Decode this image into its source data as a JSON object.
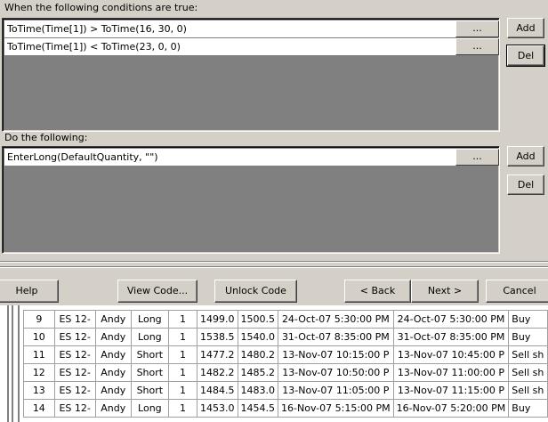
{
  "conditions": {
    "label": "When the following conditions are true:",
    "items": [
      {
        "text": "ToTime(Time[1]) > ToTime(16, 30, 0)",
        "ellipsis": "..."
      },
      {
        "text": "ToTime(Time[1]) < ToTime(23, 0, 0)",
        "ellipsis": "..."
      }
    ],
    "add_label": "Add",
    "del_label": "Del"
  },
  "actions": {
    "label": "Do the following:",
    "items": [
      {
        "text": "EnterLong(DefaultQuantity, \"\")",
        "ellipsis": "..."
      }
    ],
    "add_label": "Add",
    "del_label": "Del"
  },
  "footer": {
    "help": "Help",
    "view_code": "View Code...",
    "unlock_code": "Unlock Code",
    "back": "< Back",
    "next": "Next >",
    "cancel": "Cancel"
  },
  "trades": {
    "rows": [
      [
        "9",
        "ES 12-",
        "Andy",
        "Long",
        "1",
        "1499.0",
        "1500.5",
        "24-Oct-07 5:30:00 PM",
        "24-Oct-07 5:30:00 PM",
        "Buy"
      ],
      [
        "10",
        "ES 12-",
        "Andy",
        "Long",
        "1",
        "1538.5",
        "1540.0",
        "31-Oct-07 8:35:00 PM",
        "31-Oct-07 8:35:00 PM",
        "Buy"
      ],
      [
        "11",
        "ES 12-",
        "Andy",
        "Short",
        "1",
        "1477.2",
        "1480.2",
        "13-Nov-07 10:15:00 P",
        "13-Nov-07 10:45:00 P",
        "Sell sh"
      ],
      [
        "12",
        "ES 12-",
        "Andy",
        "Short",
        "1",
        "1482.2",
        "1485.2",
        "13-Nov-07 10:50:00 P",
        "13-Nov-07 11:00:00 P",
        "Sell sh"
      ],
      [
        "13",
        "ES 12-",
        "Andy",
        "Short",
        "1",
        "1484.5",
        "1483.0",
        "13-Nov-07 11:05:00 P",
        "13-Nov-07 11:15:00 P",
        "Sell sh"
      ],
      [
        "14",
        "ES 12-",
        "Andy",
        "Long",
        "1",
        "1453.0",
        "1454.5",
        "16-Nov-07 5:15:00 PM",
        "16-Nov-07 5:20:00 PM",
        "Buy"
      ]
    ]
  }
}
